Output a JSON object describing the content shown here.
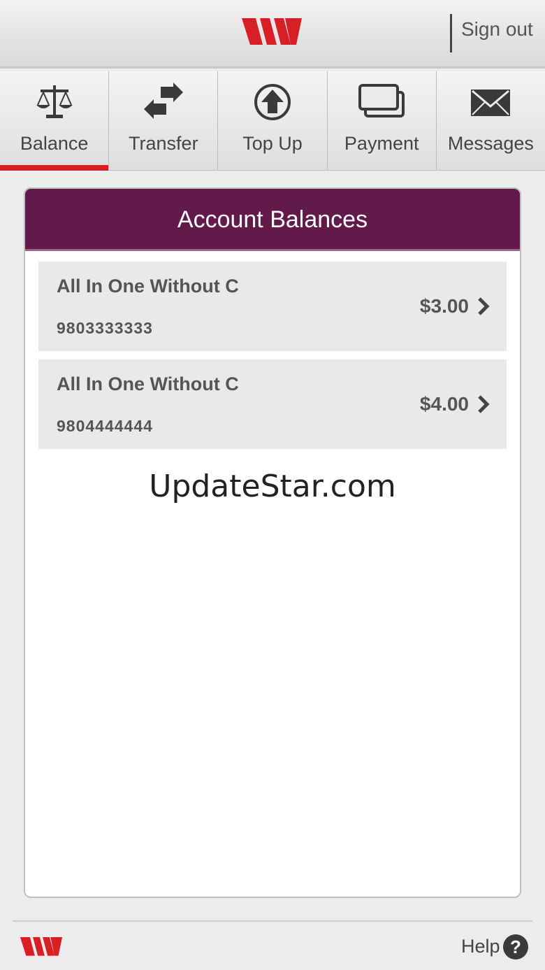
{
  "header": {
    "logo": "westpac-logo",
    "signout_label": "Sign out"
  },
  "tabs": [
    {
      "label": "Balance",
      "icon": "scales-icon",
      "active": true
    },
    {
      "label": "Transfer",
      "icon": "transfer-arrows-icon",
      "active": false
    },
    {
      "label": "Top Up",
      "icon": "arrow-up-circle-icon",
      "active": false
    },
    {
      "label": "Payment",
      "icon": "cards-icon",
      "active": false
    },
    {
      "label": "Messages",
      "icon": "envelope-icon",
      "active": false
    }
  ],
  "balances": {
    "title": "Account Balances",
    "accounts": [
      {
        "name": "All In One Without C",
        "number": "9803333333",
        "amount": "$3.00"
      },
      {
        "name": "All In One Without C",
        "number": "9804444444",
        "amount": "$4.00"
      }
    ]
  },
  "watermark": "UpdateStar.com",
  "footer": {
    "help_label": "Help",
    "help_icon_glyph": "?"
  },
  "colors": {
    "brand_red": "#d71f26",
    "header_purple": "#621a4a"
  }
}
